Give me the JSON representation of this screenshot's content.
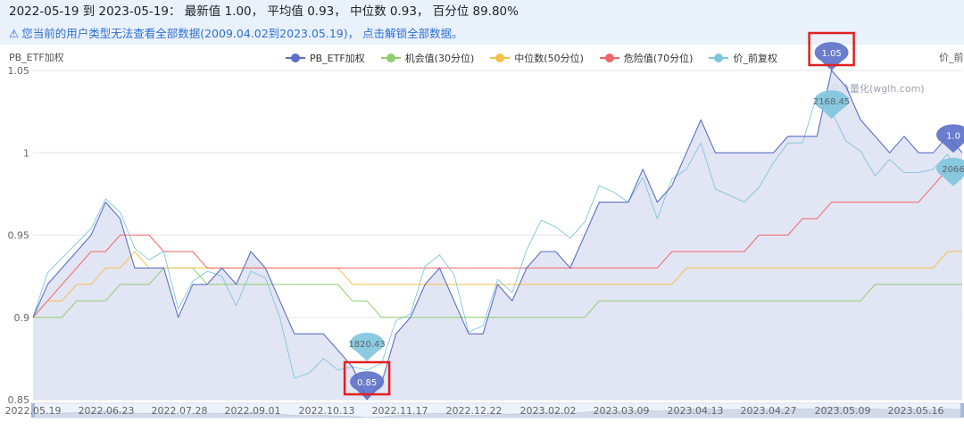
{
  "header": {
    "summary": "2022-05-19 到 2023-05-19： 最新值 1.00， 平均值 0.93， 中位数 0.93， 百分位 89.80%",
    "notice_icon": "warning-icon",
    "notice": "您当前的用户类型无法查看全部数据(2009.04.02到2023.05.19)， 点击解锁全部数据。"
  },
  "watermark": "乌龟量化(wglh.com)",
  "colors": {
    "pb": "#5b6fc8",
    "pb_fill": "#dde0f2",
    "opportunity": "#8fcf6e",
    "median": "#f5c04a",
    "danger": "#ee6666",
    "price": "#7ec5dd"
  },
  "chart_data": {
    "type": "line",
    "title": "",
    "ylabel_left": "PB_ETF加权",
    "ylabel_right": "价_前复权",
    "ylim": [
      0.85,
      1.05
    ],
    "y_ticks": [
      "0.85",
      "0.9",
      "0.95",
      "1",
      "1.05"
    ],
    "x_tick_labels": [
      "2022.05.19",
      "2022.06.23",
      "2022.07.28",
      "2022.09.01",
      "2022.10.13",
      "2022.11.17",
      "2022.12.22",
      "2023.02.02",
      "2023.03.09",
      "2023.04.13",
      "2023.04.27",
      "2023.05.09",
      "2023.05.16"
    ],
    "grid": true,
    "legend_position": "top",
    "series": [
      {
        "name": "PB_ETF加权",
        "values": [
          0.9,
          0.92,
          0.93,
          0.94,
          0.95,
          0.97,
          0.96,
          0.93,
          0.93,
          0.93,
          0.9,
          0.92,
          0.92,
          0.93,
          0.92,
          0.94,
          0.93,
          0.91,
          0.89,
          0.89,
          0.89,
          0.88,
          0.87,
          0.85,
          0.86,
          0.89,
          0.9,
          0.92,
          0.93,
          0.91,
          0.89,
          0.89,
          0.92,
          0.91,
          0.93,
          0.94,
          0.94,
          0.93,
          0.95,
          0.97,
          0.97,
          0.97,
          0.99,
          0.97,
          0.98,
          1.0,
          1.02,
          1.0,
          1.0,
          1.0,
          1.0,
          1.0,
          1.01,
          1.01,
          1.01,
          1.05,
          1.04,
          1.02,
          1.01,
          1.0,
          1.01,
          1.0,
          1.0,
          1.01,
          1.0
        ]
      },
      {
        "name": "机会值(30分位)",
        "values": [
          0.9,
          0.9,
          0.9,
          0.91,
          0.91,
          0.91,
          0.92,
          0.92,
          0.92,
          0.93,
          0.93,
          0.93,
          0.92,
          0.92,
          0.92,
          0.92,
          0.92,
          0.92,
          0.92,
          0.92,
          0.92,
          0.92,
          0.91,
          0.91,
          0.9,
          0.9,
          0.9,
          0.9,
          0.9,
          0.9,
          0.9,
          0.9,
          0.9,
          0.9,
          0.9,
          0.9,
          0.9,
          0.9,
          0.9,
          0.91,
          0.91,
          0.91,
          0.91,
          0.91,
          0.91,
          0.91,
          0.91,
          0.91,
          0.91,
          0.91,
          0.91,
          0.91,
          0.91,
          0.91,
          0.91,
          0.91,
          0.91,
          0.91,
          0.92,
          0.92,
          0.92,
          0.92,
          0.92,
          0.92,
          0.92
        ]
      },
      {
        "name": "中位数(50分位)",
        "values": [
          0.9,
          0.91,
          0.91,
          0.92,
          0.92,
          0.93,
          0.93,
          0.94,
          0.93,
          0.93,
          0.93,
          0.93,
          0.93,
          0.93,
          0.93,
          0.93,
          0.93,
          0.93,
          0.93,
          0.93,
          0.93,
          0.93,
          0.92,
          0.92,
          0.92,
          0.92,
          0.92,
          0.92,
          0.92,
          0.92,
          0.92,
          0.92,
          0.92,
          0.92,
          0.92,
          0.92,
          0.92,
          0.92,
          0.92,
          0.92,
          0.92,
          0.92,
          0.92,
          0.92,
          0.92,
          0.93,
          0.93,
          0.93,
          0.93,
          0.93,
          0.93,
          0.93,
          0.93,
          0.93,
          0.93,
          0.93,
          0.93,
          0.93,
          0.93,
          0.93,
          0.93,
          0.93,
          0.93,
          0.94,
          0.94
        ]
      },
      {
        "name": "危险值(70分位)",
        "values": [
          0.9,
          0.91,
          0.92,
          0.93,
          0.94,
          0.94,
          0.95,
          0.95,
          0.95,
          0.94,
          0.94,
          0.94,
          0.93,
          0.93,
          0.93,
          0.93,
          0.93,
          0.93,
          0.93,
          0.93,
          0.93,
          0.93,
          0.93,
          0.93,
          0.93,
          0.93,
          0.93,
          0.93,
          0.93,
          0.93,
          0.93,
          0.93,
          0.93,
          0.93,
          0.93,
          0.93,
          0.93,
          0.93,
          0.93,
          0.93,
          0.93,
          0.93,
          0.93,
          0.93,
          0.94,
          0.94,
          0.94,
          0.94,
          0.94,
          0.94,
          0.95,
          0.95,
          0.95,
          0.96,
          0.96,
          0.97,
          0.97,
          0.97,
          0.97,
          0.97,
          0.97,
          0.97,
          0.98,
          0.99,
          0.99
        ]
      },
      {
        "name": "价_前复权",
        "values": [
          0.9,
          0.927,
          0.936,
          0.945,
          0.954,
          0.972,
          0.964,
          0.942,
          0.935,
          0.94,
          0.905,
          0.922,
          0.928,
          0.925,
          0.907,
          0.928,
          0.924,
          0.9,
          0.863,
          0.866,
          0.875,
          0.868,
          0.87,
          0.868,
          0.872,
          0.898,
          0.902,
          0.931,
          0.938,
          0.926,
          0.891,
          0.895,
          0.923,
          0.915,
          0.941,
          0.959,
          0.955,
          0.948,
          0.958,
          0.98,
          0.976,
          0.97,
          0.985,
          0.96,
          0.984,
          0.99,
          1.006,
          0.978,
          0.974,
          0.97,
          0.979,
          0.994,
          1.006,
          1.006,
          1.035,
          1.025,
          1.007,
          1.001,
          0.986,
          0.996,
          0.988,
          0.988,
          0.99,
          0.999,
          0.984
        ]
      }
    ],
    "markers": [
      {
        "label": "1.05",
        "series": "PB_ETF加权",
        "index": 55,
        "highlighted": true
      },
      {
        "label": "2168.45",
        "series": "价_前复权",
        "index": 55,
        "highlighted": false
      },
      {
        "label": "0.85",
        "series": "PB_ETF加权",
        "index": 23,
        "highlighted": true
      },
      {
        "label": "1820.43",
        "series": "价_前复权",
        "index": 23,
        "highlighted": false
      },
      {
        "label": "1.0",
        "series": "PB_ETF加权",
        "index": 64,
        "highlighted": false
      },
      {
        "label": "2066",
        "series": "价_前复权",
        "index": 64,
        "highlighted": false
      }
    ]
  }
}
